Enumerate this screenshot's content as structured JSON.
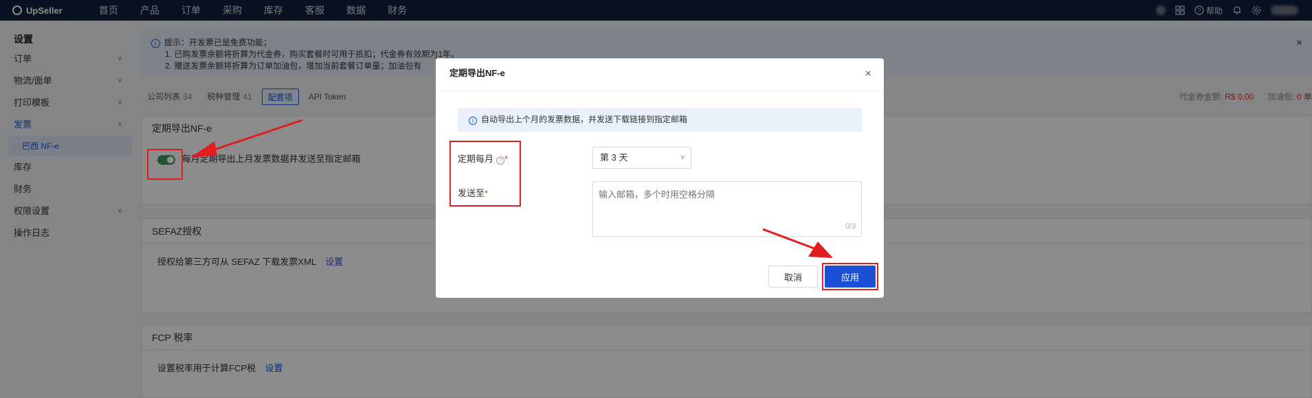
{
  "app": {
    "brand": "UpSeller"
  },
  "nav": [
    "首页",
    "产品",
    "订单",
    "采购",
    "库存",
    "客服",
    "数据",
    "财务"
  ],
  "topbar": {
    "help_label": "帮助"
  },
  "sidebar": {
    "title": "设置",
    "items": [
      {
        "label": "订单",
        "chevron": "∨"
      },
      {
        "label": "物流/面单",
        "chevron": "∨"
      },
      {
        "label": "打印模板",
        "chevron": "∨"
      },
      {
        "label": "发票",
        "chevron": "∧"
      },
      {
        "label": "巴西 NF-e"
      },
      {
        "label": "库存"
      },
      {
        "label": "财务"
      },
      {
        "label": "权限设置",
        "chevron": "∨"
      },
      {
        "label": "操作日志"
      }
    ]
  },
  "notice": {
    "line1": "提示：开发票已是免费功能；",
    "line2": "1. 已购发票余额将折算为代金券，购买套餐时可用于抵扣；代金券有效期为1年。",
    "line3": "2. 赠送发票余额将折算为订单加油包，增加当前套餐订单量；加油包有",
    "close": "×"
  },
  "tabs": [
    {
      "label": "公司列表",
      "count": "34"
    },
    {
      "label": "税种管理",
      "count": "41"
    },
    {
      "label": "配置项",
      "count": ""
    },
    {
      "label": "API Token",
      "count": ""
    }
  ],
  "balances": {
    "voucher_label": "代金券金额:",
    "voucher_value": "R$ 0,00",
    "fuel_label": "加油包:",
    "fuel_value": "0 单"
  },
  "cards": {
    "nfe": {
      "title": "定期导出NF-e",
      "toggle_text": "每月定期导出上月发票数据并发送至指定邮箱"
    },
    "sefaz": {
      "title": "SEFAZ授权",
      "text": "授权给第三方可从 SEFAZ 下载发票XML",
      "link": "设置"
    },
    "fcp": {
      "title": "FCP 税率",
      "text": "设置税率用于计算FCP税",
      "link": "设置"
    }
  },
  "modal": {
    "title": "定期导出NF-e",
    "close": "×",
    "tip": "自动导出上个月的发票数据，并发送下载链接到指定邮箱",
    "monthly_label": "定期每月",
    "send_label": "发送至",
    "required": "*",
    "select_value": "第 3 天",
    "email_placeholder": "输入邮箱，多个时用空格分隔",
    "email_count": "0/3",
    "cancel": "取消",
    "apply": "应用"
  },
  "colors": {
    "topbar": "#0d1f3a",
    "accent": "#1a56db",
    "toggle_on": "#3c9a5a",
    "annotation": "#e01e1e"
  }
}
